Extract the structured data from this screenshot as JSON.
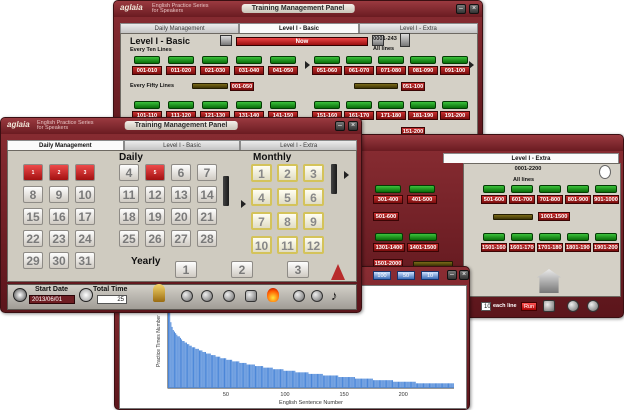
{
  "back_window": {
    "title": "Training Management Panel",
    "logo": "aglaia",
    "brand": "English Practice Series for Speakers",
    "tabs": [
      "Daily Management",
      "Level I - Basic",
      "Level I - Extra"
    ],
    "level_title": "Level I - Basic",
    "progress_label": "Now",
    "range_label": "0001-243",
    "all_lines": "All lines",
    "every_ten": "Every Ten Lines",
    "every_fifty": "Every Fifty Lines",
    "ten_row1": [
      "001-010",
      "011-020",
      "021-030",
      "031-040",
      "041-050"
    ],
    "ten_row2": [
      "051-060",
      "061-070",
      "071-080",
      "081-090",
      "091-100"
    ],
    "ten_row3": [
      "101-110",
      "111-120",
      "121-130",
      "131-140",
      "141-150"
    ],
    "ten_row4": [
      "151-160",
      "161-170",
      "171-180",
      "181-190",
      "191-200"
    ],
    "fifty": [
      "001-050",
      "051-100",
      "151-200"
    ]
  },
  "right_window": {
    "tab": "Level I - Extra",
    "range_label": "0001-2200",
    "all_lines": "All lines",
    "row1": [
      "301-400",
      "401-500"
    ],
    "row1b": [
      "501-600",
      "601-700",
      "701-800",
      "801-900",
      "901-1000"
    ],
    "row2": [
      "1301-1400",
      "1401-1500"
    ],
    "row2b": [
      "1501-1600",
      "1601-1700",
      "1701-1800",
      "1801-1900",
      "1901-2000"
    ],
    "solo": "501-600",
    "solo2": "1001-1500",
    "solo3": "1501-2000",
    "each_line": "each line",
    "each_value": "10",
    "run": "Run"
  },
  "chart_window": {
    "chips": [
      "100",
      "50",
      "10"
    ],
    "chart_data": {
      "type": "bar",
      "xlabel": "English Sentence Number",
      "ylabel": "Practice Times Number",
      "xticks": [
        "50",
        "100",
        "150",
        "200"
      ],
      "xlim": [
        1,
        243
      ],
      "values": [
        60,
        48,
        42,
        39,
        37,
        36,
        35,
        34,
        33,
        33,
        32,
        31,
        30,
        30,
        29,
        29,
        28,
        28,
        27,
        27,
        26,
        26,
        26,
        25,
        25,
        25,
        24,
        24,
        24,
        23,
        23,
        23,
        22,
        22,
        22,
        22,
        21,
        21,
        21,
        21,
        20,
        20,
        20,
        20,
        19,
        19,
        19,
        19,
        19,
        18,
        18,
        18,
        18,
        18,
        17,
        17,
        17,
        17,
        17,
        17,
        16,
        16,
        16,
        16,
        16,
        16,
        15,
        15,
        15,
        15,
        15,
        15,
        15,
        14,
        14,
        14,
        14,
        14,
        14,
        14,
        13,
        13,
        13,
        13,
        13,
        13,
        13,
        13,
        12,
        12,
        12,
        12,
        12,
        12,
        12,
        12,
        12,
        11,
        11,
        11,
        11,
        11,
        11,
        11,
        11,
        11,
        11,
        10,
        10,
        10,
        10,
        10,
        10,
        10,
        10,
        10,
        10,
        10,
        9,
        9,
        9,
        9,
        9,
        9,
        9,
        9,
        9,
        9,
        9,
        9,
        8,
        8,
        8,
        8,
        8,
        8,
        8,
        8,
        8,
        8,
        8,
        8,
        8,
        7,
        7,
        7,
        7,
        7,
        7,
        7,
        7,
        7,
        7,
        7,
        7,
        7,
        7,
        6,
        6,
        6,
        6,
        6,
        6,
        6,
        6,
        6,
        6,
        6,
        6,
        6,
        6,
        6,
        5,
        5,
        5,
        5,
        5,
        5,
        5,
        5,
        5,
        5,
        5,
        5,
        5,
        5,
        5,
        5,
        5,
        4,
        4,
        4,
        4,
        4,
        4,
        4,
        4,
        4,
        4,
        4,
        4,
        4,
        4,
        4,
        4,
        4,
        4,
        4,
        3,
        3,
        3,
        3,
        3,
        3,
        3,
        3,
        3,
        3,
        3,
        3,
        3,
        3,
        3,
        3,
        3,
        3,
        3,
        3,
        3,
        3,
        3,
        3,
        3,
        3,
        3,
        3,
        3,
        3,
        3,
        3
      ]
    }
  },
  "front_window": {
    "title": "Training Management Panel",
    "logo": "aglaia",
    "brand": "English Practice Series for Speakers",
    "tabs": [
      "Daily Management",
      "Level I - Basic",
      "Level I - Extra"
    ],
    "daily": "Daily",
    "monthly": "Monthly",
    "yearly": "Yearly",
    "days": [
      "1",
      "2",
      "3",
      "4",
      "5",
      "6",
      "7",
      "8",
      "9",
      "10",
      "11",
      "12",
      "13",
      "14",
      "15",
      "16",
      "17",
      "18",
      "19",
      "20",
      "21",
      "22",
      "23",
      "24",
      "25",
      "26",
      "27",
      "28",
      "29",
      "30",
      "31"
    ],
    "red_days": [
      "1",
      "2",
      "3",
      "5"
    ],
    "months": [
      "1",
      "2",
      "3",
      "4",
      "5",
      "6",
      "7",
      "8",
      "9",
      "10",
      "11",
      "12"
    ],
    "years": [
      "1",
      "2",
      "3"
    ],
    "start_date_label": "Start Date",
    "start_date": "2013/06/01",
    "total_time_label": "Total Time",
    "total_time": "25"
  }
}
